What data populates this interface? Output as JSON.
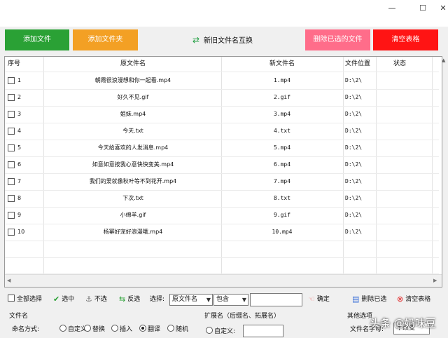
{
  "window": {
    "minimize": "—",
    "maximize": "☐",
    "close": "✕"
  },
  "toolbar": {
    "add_file": "添加文件",
    "add_folder": "添加文件夹",
    "swap_names": "新旧文件名互换",
    "delete_selected_files": "删除已选的文件",
    "clear_table": "清空表格",
    "colors": {
      "add_file": "#2aa135",
      "add_folder": "#f3a024",
      "delete": "#ff6d8a",
      "clear": "#ff1414"
    }
  },
  "table": {
    "headers": {
      "index": "序号",
      "original_name": "原文件名",
      "new_name": "新文件名",
      "location": "文件位置",
      "status": "状态"
    },
    "rows": [
      {
        "index": "1",
        "original": "朝霞很浪漫想和你一起看.mp4",
        "new": "1.mp4",
        "location": "D:\\2\\",
        "status": ""
      },
      {
        "index": "2",
        "original": "好久不见.gif",
        "new": "2.gif",
        "location": "D:\\2\\",
        "status": ""
      },
      {
        "index": "3",
        "original": "姐妹.mp4",
        "new": "3.mp4",
        "location": "D:\\2\\",
        "status": ""
      },
      {
        "index": "4",
        "original": "今天.txt",
        "new": "4.txt",
        "location": "D:\\2\\",
        "status": ""
      },
      {
        "index": "5",
        "original": "今天给喜欢的人发消息.mp4",
        "new": "5.mp4",
        "location": "D:\\2\\",
        "status": ""
      },
      {
        "index": "6",
        "original": "如意如意按我心意快快变美.mp4",
        "new": "6.mp4",
        "location": "D:\\2\\",
        "status": ""
      },
      {
        "index": "7",
        "original": "我们的爱就像秋叶等不到花开.mp4",
        "new": "7.mp4",
        "location": "D:\\2\\",
        "status": ""
      },
      {
        "index": "8",
        "original": "下次.txt",
        "new": "8.txt",
        "location": "D:\\2\\",
        "status": ""
      },
      {
        "index": "9",
        "original": "小绵羊.gif",
        "new": "9.gif",
        "location": "D:\\2\\",
        "status": ""
      },
      {
        "index": "10",
        "original": "杨幂好宠好浪漫哦.mp4",
        "new": "10.mp4",
        "location": "D:\\2\\",
        "status": ""
      }
    ]
  },
  "bottombar": {
    "select_all": "全部选择",
    "select": "选中",
    "deselect": "不选",
    "invert": "反选",
    "choose_label": "选择:",
    "field_select": "原文件名",
    "match_select": "包含",
    "filter_value": "",
    "confirm": "确定",
    "delete_selected": "删除已选",
    "clear_table": "清空表格"
  },
  "filename_panel": {
    "title": "文件名",
    "naming_label": "命名方式:",
    "options": [
      "自定义",
      "替换",
      "插入",
      "翻译",
      "随机"
    ],
    "selected": "翻译"
  },
  "extension_panel": {
    "title": "扩展名（后缀名、拓展名）",
    "custom_label": "自定义:",
    "custom_value": ""
  },
  "other_panel": {
    "title": "其他选项",
    "case_label": "文件名字母:",
    "case_value": "不改变"
  },
  "watermark": "头条 @奶味豆"
}
